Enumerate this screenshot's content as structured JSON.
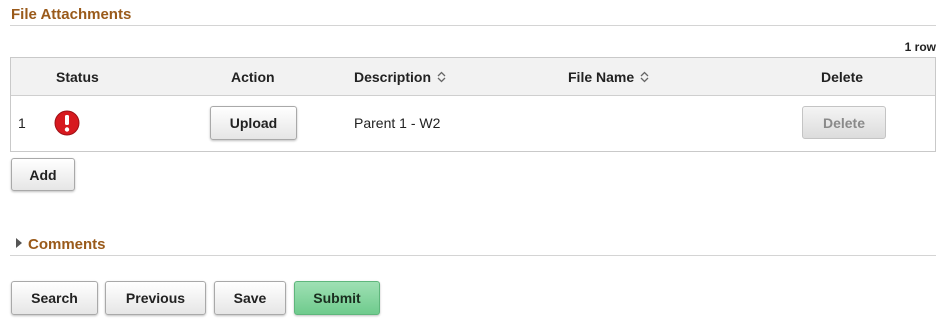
{
  "attachments": {
    "title": "File Attachments",
    "row_count": "1 row",
    "columns": {
      "status": "Status",
      "action": "Action",
      "description": "Description",
      "file_name": "File Name",
      "delete": "Delete"
    },
    "rows": [
      {
        "row_number": "1",
        "status_icon": "error-exclamation-icon",
        "action_label": "Upload",
        "description": "Parent 1 - W2",
        "file_name": "",
        "delete_label": "Delete"
      }
    ],
    "add_label": "Add"
  },
  "comments": {
    "title": "Comments",
    "icon": "caret-right-icon"
  },
  "footer": {
    "search_label": "Search",
    "previous_label": "Previous",
    "save_label": "Save",
    "submit_label": "Submit"
  },
  "colors": {
    "section_title": "#9a5a1a",
    "error": "#d7191f",
    "submit": "#7fd49b"
  }
}
